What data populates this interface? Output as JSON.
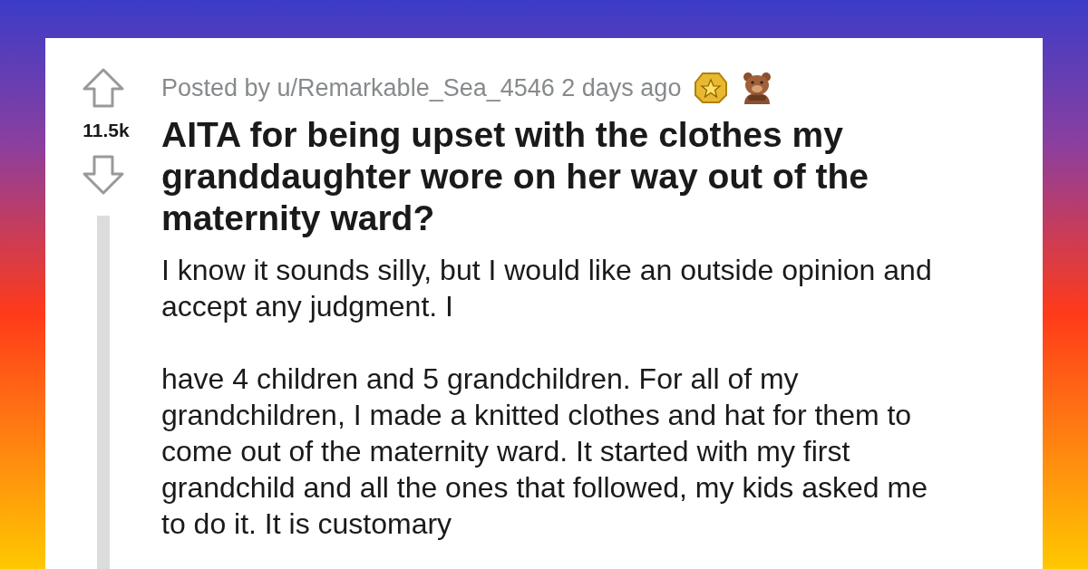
{
  "post": {
    "score": "11.5k",
    "byline": "Posted by u/Remarkable_Sea_4546 2 days ago",
    "title": "AITA for being upset with the clothes my granddaughter wore on her way out of the maternity ward?",
    "paragraphs": [
      "I know it sounds silly, but I would like an outside opinion and accept any judgment. I",
      "have 4 children and 5 grandchildren. For all of my grandchildren, I made a knitted clothes and hat for them to come out of the maternity ward. It started with my first grandchild and all the ones that followed, my kids asked me to do it. It is customary"
    ]
  }
}
